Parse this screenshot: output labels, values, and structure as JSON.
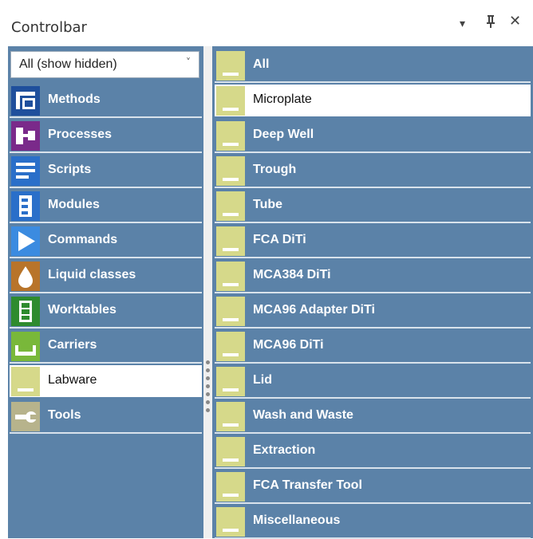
{
  "window": {
    "title": "Controlbar",
    "dropdown_glyph": "▾",
    "pin_glyph": "ᵖ",
    "close_glyph": "✕"
  },
  "filter": {
    "selected": "All (show hidden)",
    "chevron": "˅"
  },
  "left_items": [
    {
      "label": "Methods",
      "icon": "methods-icon",
      "color": "#1f4f9c"
    },
    {
      "label": "Processes",
      "icon": "processes-icon",
      "color": "#7a2a8a"
    },
    {
      "label": "Scripts",
      "icon": "scripts-icon",
      "color": "#2a6fc9"
    },
    {
      "label": "Modules",
      "icon": "modules-icon",
      "color": "#2a6fc9"
    },
    {
      "label": "Commands",
      "icon": "commands-icon",
      "color": "#3b8be0"
    },
    {
      "label": "Liquid classes",
      "icon": "liquid-drop-icon",
      "color": "#b8742a"
    },
    {
      "label": "Worktables",
      "icon": "worktables-icon",
      "color": "#2e8b2e"
    },
    {
      "label": "Carriers",
      "icon": "carriers-icon",
      "color": "#79b83a"
    },
    {
      "label": "Labware",
      "icon": "labware-icon",
      "color": "#d6d98a",
      "selected": true
    },
    {
      "label": "Tools",
      "icon": "tools-icon",
      "color": "#b7b38c"
    }
  ],
  "right_items": [
    {
      "label": "All"
    },
    {
      "label": "Microplate",
      "selected": true
    },
    {
      "label": "Deep Well"
    },
    {
      "label": "Trough"
    },
    {
      "label": "Tube"
    },
    {
      "label": "FCA DiTi"
    },
    {
      "label": "MCA384 DiTi"
    },
    {
      "label": "MCA96 Adapter DiTi"
    },
    {
      "label": "MCA96 DiTi"
    },
    {
      "label": "Lid"
    },
    {
      "label": "Wash and Waste"
    },
    {
      "label": "Extraction"
    },
    {
      "label": "FCA Transfer Tool"
    },
    {
      "label": "Miscellaneous"
    }
  ],
  "colors": {
    "panel": "#5b82a8",
    "labware": "#d6d98a",
    "selected_bg": "#ffffff"
  }
}
